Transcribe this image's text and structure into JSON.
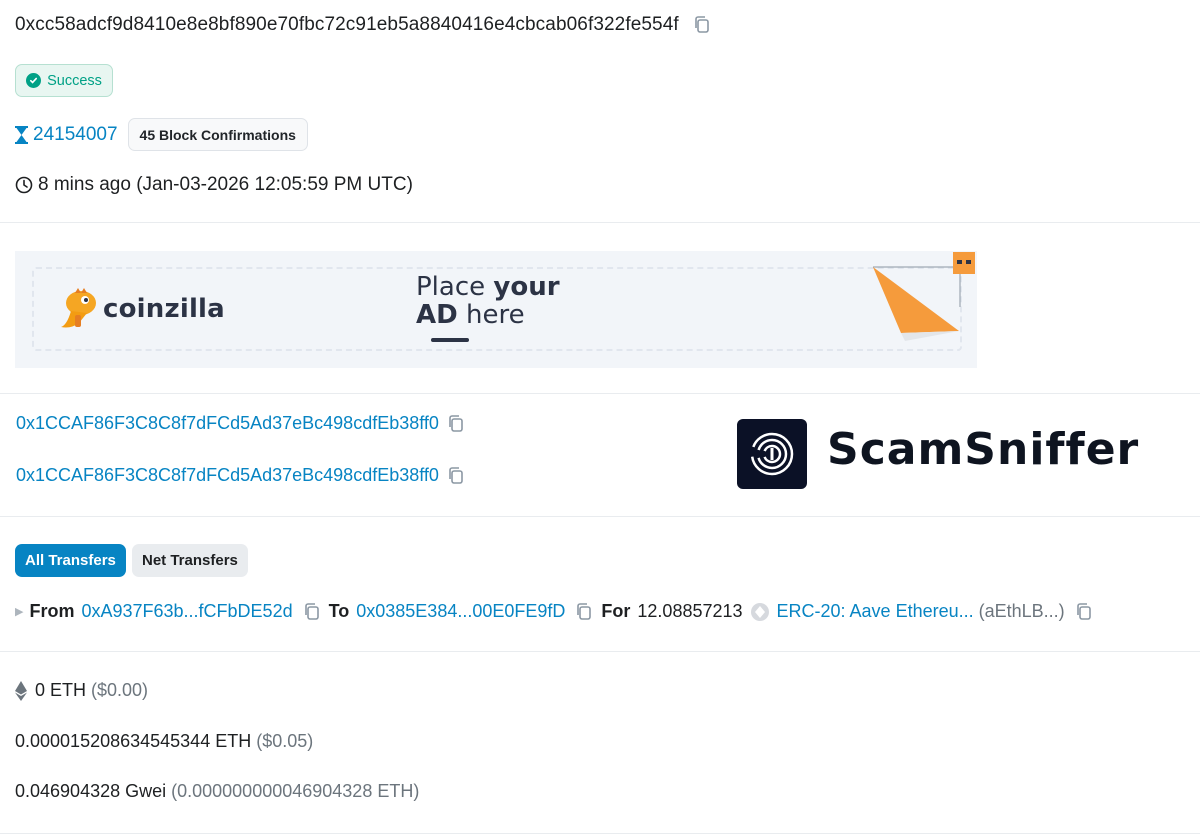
{
  "transaction": {
    "hash": "0xcc58adcf9d8410e8e8bf890e70fbc72c91eb5a8840416e4cbcab06f322fe554f",
    "status": "Success",
    "block": "24154007",
    "confirmations": "45 Block Confirmations",
    "timestamp": "8 mins ago (Jan-03-2026 12:05:59 PM UTC)"
  },
  "ad": {
    "brand": "coinzilla",
    "line1_a": "Place ",
    "line1_b": "your",
    "line2_a": "AD",
    "line2_b": " here"
  },
  "addresses": {
    "from": "0x1CCAF86F3C8C8f7dFCd5Ad37eBc498cdfEb38ff0",
    "interacted_with": "0x1CCAF86F3C8C8f7dFCd5Ad37eBc498cdfEb38ff0"
  },
  "watermark": {
    "name": "ScamSniffer"
  },
  "transfers": {
    "tabs": [
      "All Transfers",
      "Net Transfers"
    ],
    "from_label": "From",
    "from": "0xA937F63b...fCFbDE52d",
    "to_label": "To",
    "to": "0x0385E384...00E0FE9fD",
    "for_label": "For",
    "amount": "12.08857213",
    "token": "ERC-20: Aave Ethereu...",
    "token_symbol": "(aEthLB...)"
  },
  "value": {
    "amount": "0 ETH",
    "usd": "($0.00)"
  },
  "fee": {
    "amount": "0.000015208634545344 ETH",
    "usd": "($0.05)"
  },
  "gas_price": {
    "gwei": "0.046904328 Gwei",
    "eth": "(0.000000000046904328 ETH)"
  },
  "colors": {
    "link": "#0784c3",
    "success": "#00a186",
    "ad_accent": "#f59b3c"
  }
}
